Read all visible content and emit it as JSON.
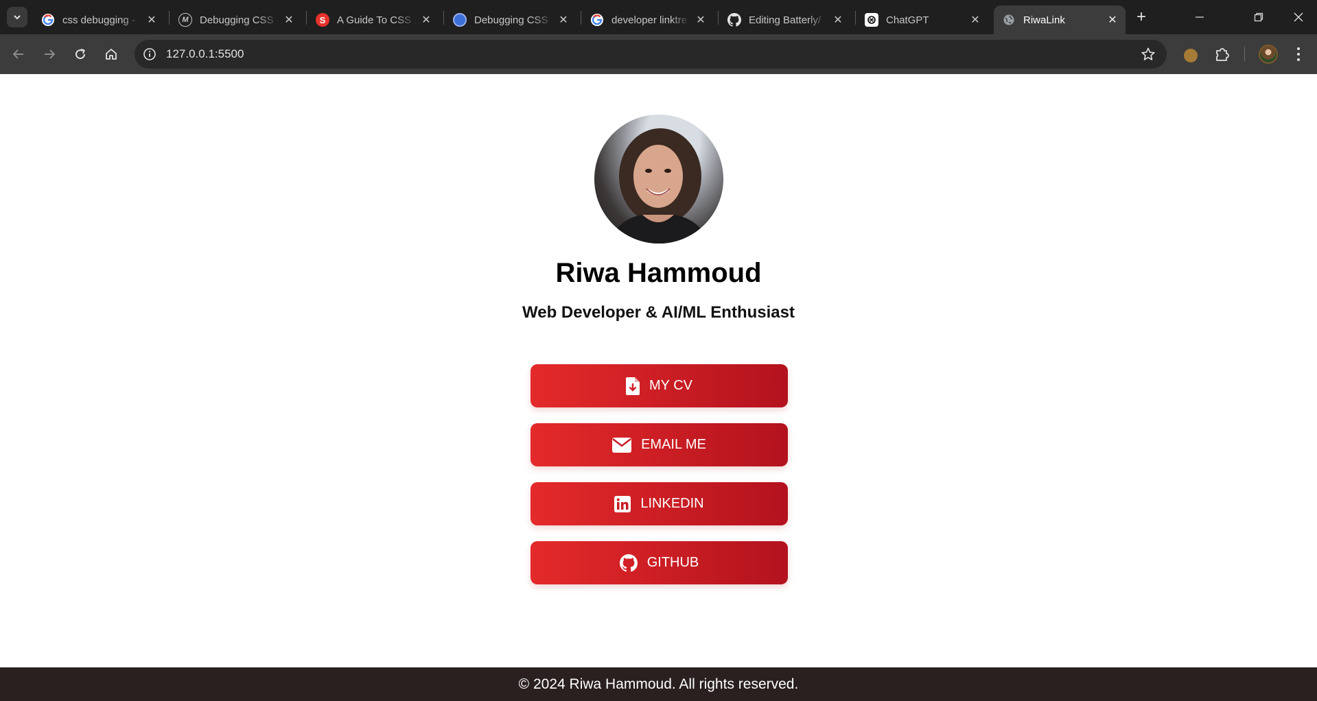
{
  "browser": {
    "tabs": [
      {
        "title": "css debugging -",
        "favicon": "google-icon",
        "active": false
      },
      {
        "title": "Debugging CSS",
        "favicon": "medium-icon",
        "active": false
      },
      {
        "title": "A Guide To CSS D",
        "favicon": "smashing-icon",
        "active": false
      },
      {
        "title": "Debugging CSS",
        "favicon": "globe-blue-icon",
        "active": false
      },
      {
        "title": "developer linktre",
        "favicon": "google-icon",
        "active": false
      },
      {
        "title": "Editing Batterly/",
        "favicon": "github-icon",
        "active": false
      },
      {
        "title": "ChatGPT",
        "favicon": "chatgpt-icon",
        "active": false
      },
      {
        "title": "RiwaLink",
        "favicon": "globe-icon",
        "active": true
      }
    ],
    "address": "127.0.0.1:5500"
  },
  "profile": {
    "name": "Riwa Hammoud",
    "subtitle": "Web Developer & AI/ML Enthusiast"
  },
  "links": [
    {
      "label": "MY CV",
      "icon": "file-download-icon"
    },
    {
      "label": "EMAIL ME",
      "icon": "envelope-icon"
    },
    {
      "label": "LINKEDIN",
      "icon": "linkedin-icon"
    },
    {
      "label": "GITHUB",
      "icon": "github-icon"
    }
  ],
  "footer": {
    "text": "© 2024 Riwa Hammoud. All rights reserved."
  },
  "colors": {
    "button_gradient_start": "#e42a2a",
    "button_gradient_end": "#b3121e",
    "footer_bg": "#2a2020",
    "browser_frame": "#1f1f1f"
  }
}
